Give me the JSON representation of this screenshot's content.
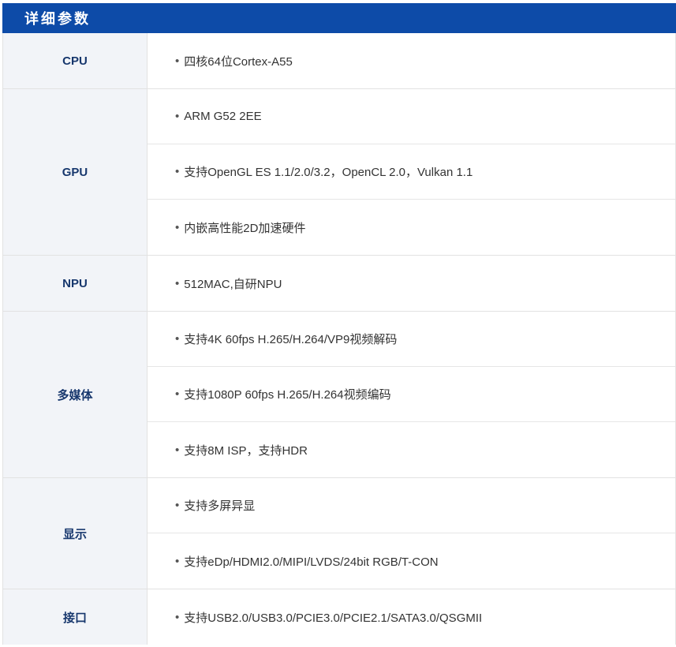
{
  "header": {
    "title": "详细参数"
  },
  "sections": [
    {
      "label": "CPU",
      "items": [
        "四核64位Cortex-A55"
      ]
    },
    {
      "label": "GPU",
      "items": [
        "ARM G52 2EE",
        "支持OpenGL ES 1.1/2.0/3.2，OpenCL 2.0，Vulkan 1.1",
        "内嵌高性能2D加速硬件"
      ]
    },
    {
      "label": "NPU",
      "items": [
        "512MAC,自研NPU"
      ]
    },
    {
      "label": "多媒体",
      "items": [
        "支持4K 60fps H.265/H.264/VP9视频解码",
        "支持1080P 60fps H.265/H.264视频编码",
        "支持8M ISP，支持HDR"
      ]
    },
    {
      "label": "显示",
      "items": [
        "支持多屏异显",
        "支持eDp/HDMI2.0/MIPI/LVDS/24bit RGB/T-CON"
      ]
    },
    {
      "label": "接口",
      "items": [
        "支持USB2.0/USB3.0/PCIE3.0/PCIE2.1/SATA3.0/QSGMII"
      ]
    }
  ],
  "bullet": "•"
}
